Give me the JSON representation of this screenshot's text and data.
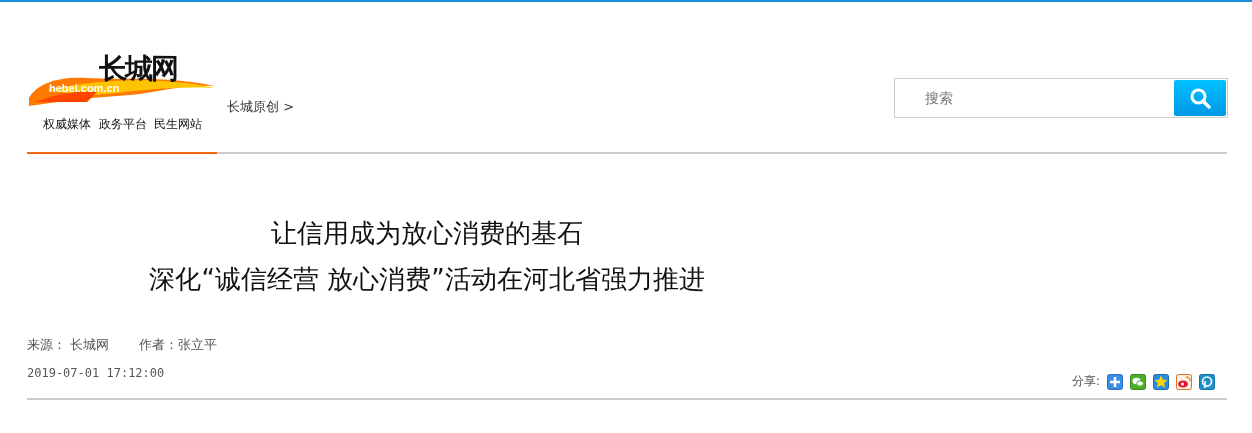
{
  "logo": {
    "name": "长城网",
    "domain": "hebei.com.cn",
    "slogan": "权威媒体  政务平台  民生网站"
  },
  "breadcrumb": {
    "label": "长城原创",
    "separator": ">"
  },
  "search": {
    "placeholder": "搜索"
  },
  "article": {
    "title_lines": [
      "让信用成为放心消费的基石",
      "深化“诚信经营 放心消费”活动在河北省强力推进"
    ],
    "source_label": "来源：",
    "source": "长城网",
    "author_label": "作者：",
    "author": "张立平",
    "date": "2019-07-01 17:12:00"
  },
  "share": {
    "label": "分享:",
    "targets": [
      {
        "kind": "more"
      },
      {
        "kind": "wechat"
      },
      {
        "kind": "qzone"
      },
      {
        "kind": "weibo"
      },
      {
        "kind": "pengyou"
      }
    ]
  }
}
